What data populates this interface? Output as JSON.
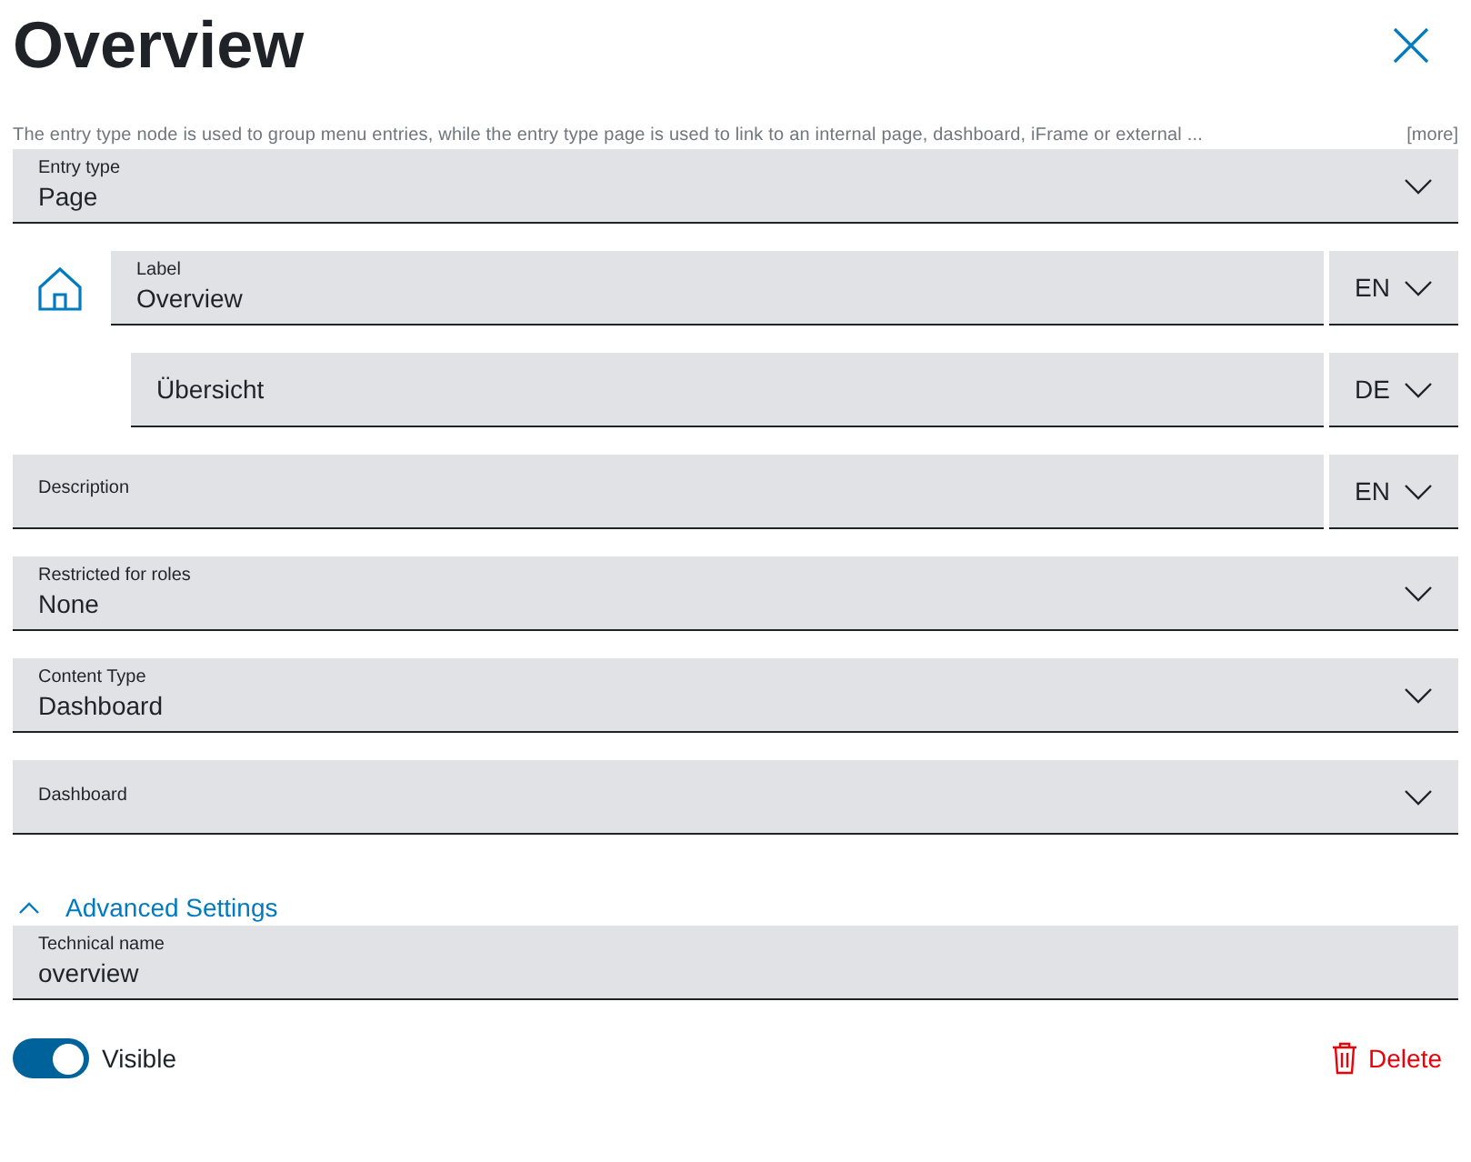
{
  "title": "Overview",
  "hint": {
    "text": "The entry type node is used to group menu entries, while the entry type page is used to link to an internal page, dashboard, iFrame or external ...",
    "more": "[more]"
  },
  "entry_type": {
    "label": "Entry type",
    "value": "Page"
  },
  "label_field": {
    "label": "Label",
    "value": "Overview",
    "lang": "EN"
  },
  "translation": {
    "value": "Übersicht",
    "lang": "DE"
  },
  "description": {
    "label": "Description",
    "lang": "EN"
  },
  "selects": [
    {
      "label": "Restricted for roles",
      "value": "None"
    },
    {
      "label": "Content Type",
      "value": "Dashboard"
    },
    {
      "label": "Dashboard"
    }
  ],
  "advanced": {
    "label": "Advanced Settings",
    "expanded": true
  },
  "technical": {
    "label": "Technical name",
    "value": "overview"
  },
  "visible": {
    "label": "Visible",
    "on": true
  },
  "delete": "Delete"
}
